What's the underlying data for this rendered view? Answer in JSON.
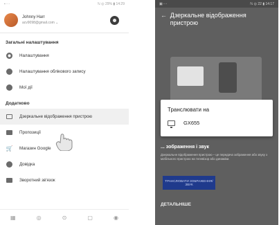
{
  "left": {
    "status": {
      "left": "▪ ◦ ◦",
      "right": "ℕ ◎ 29% ▮ 14:29"
    },
    "account": {
      "name": "Johnny Harr",
      "email": "acv9098@gmail.com ⌄"
    },
    "section_general": "Загальні налаштування",
    "items_general": [
      {
        "label": "Налаштування",
        "icon": "gear-icon"
      },
      {
        "label": "Налаштування облікового   запису",
        "icon": "account-icon"
      },
      {
        "label": "Мої дії",
        "icon": "history-icon"
      }
    ],
    "section_extra": "Додатково",
    "items_extra": [
      {
        "label": "Дзеркальне відображення пристрою",
        "icon": "cast-icon"
      },
      {
        "label": "Пропозиції",
        "icon": "feedback-icon"
      },
      {
        "label": "Магазин Google",
        "icon": "cart-icon"
      },
      {
        "label": "Довідка",
        "icon": "help-icon"
      },
      {
        "label": "Зворотний зв'язок",
        "icon": "feedback-icon"
      }
    ],
    "bottom_nav": [
      "▦",
      "◎",
      "⊙",
      "▢",
      "◉"
    ]
  },
  "right": {
    "status": {
      "left": "▣ ◦ ◦",
      "right": "ℕ ◎ 22 ▮ 14:17"
    },
    "title": "Дзеркальне відображення пристрою",
    "cast_dialog": {
      "title": "Транслювати на",
      "device": "GX655"
    },
    "section_heading": "... зображення і звук",
    "description": "Дзеркальне відображення пристрою – це передача зображення або звуку з мобільного пристрою на телевізор або динаміки.",
    "button": "ТРАНСЛЮВАТИ ЗОБРАЖЕННЯ/ЗВУК",
    "more": "ДЕТАЛЬНІШЕ"
  },
  "colors": {
    "accent": "#1f3a8c",
    "scrim": "#5f5f5f"
  }
}
